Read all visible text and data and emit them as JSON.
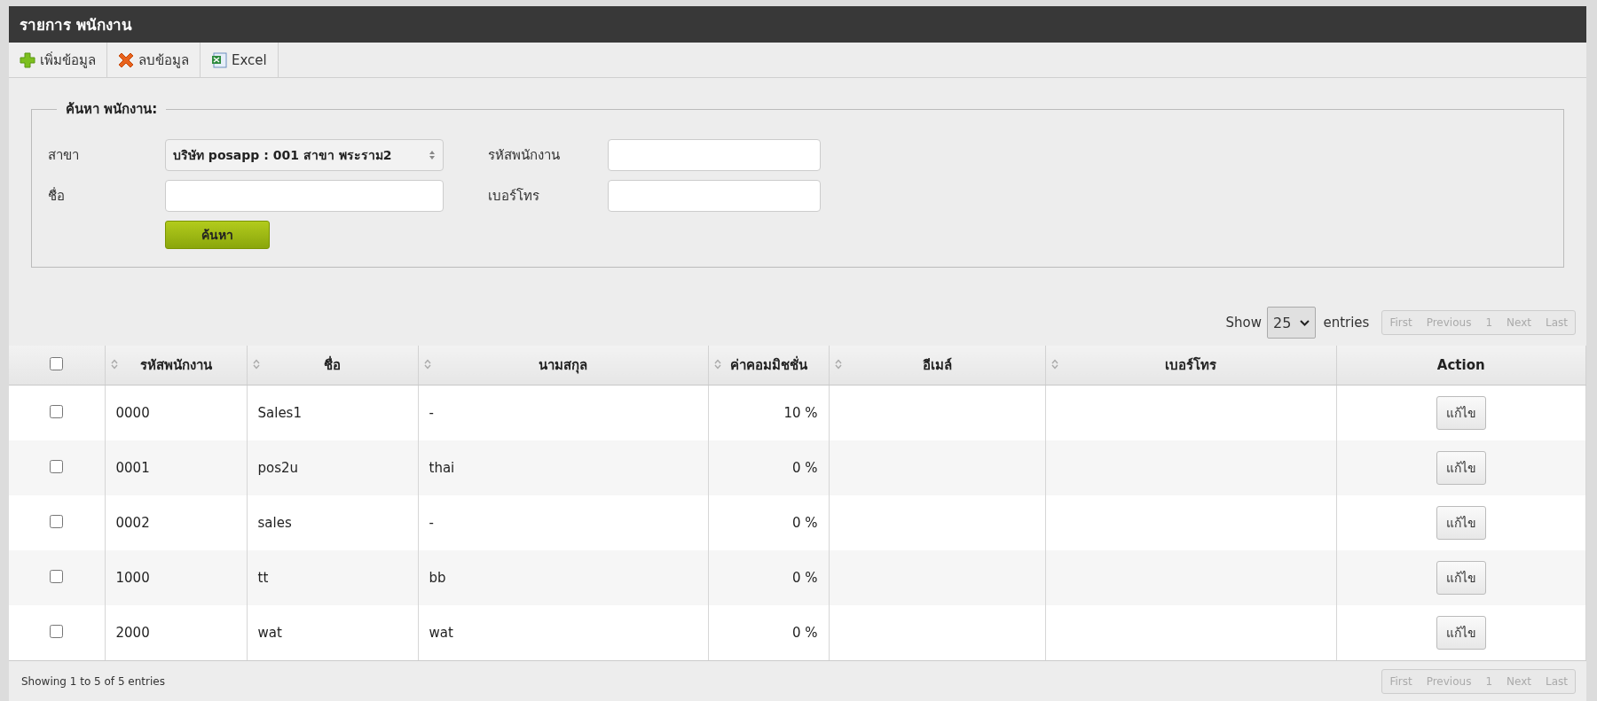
{
  "window": {
    "title": "รายการ พนักงาน"
  },
  "toolbar": [
    {
      "kind": "add",
      "label": "เพิ่มข้อมูล"
    },
    {
      "kind": "delete",
      "label": "ลบข้อมูล"
    },
    {
      "kind": "excel",
      "label": "Excel"
    }
  ],
  "search": {
    "legend": "ค้นหา พนักงาน:",
    "fields": [
      {
        "kind": "select",
        "label": "สาขา",
        "value": "บริษัท posapp : 001 สาขา พระราม2"
      },
      {
        "kind": "text",
        "label": "รหัสพนักงาน"
      },
      {
        "kind": "text",
        "label": "ชื่อ"
      },
      {
        "kind": "text",
        "label": "เบอร์โทร"
      }
    ],
    "button": "ค้นหา"
  },
  "length": {
    "before": "Show",
    "value": "25",
    "after": "entries"
  },
  "pagination_top": [
    {
      "label": "First",
      "disabled": true
    },
    {
      "label": "Previous",
      "disabled": true
    },
    {
      "label": "1",
      "disabled": true
    },
    {
      "label": "Next",
      "disabled": true
    },
    {
      "label": "Last",
      "disabled": true
    }
  ],
  "table": {
    "select_all": {
      "checked": false
    },
    "columns": [
      {
        "label": "รหัสพนักงาน",
        "sortable": true
      },
      {
        "label": "ชื่อ",
        "sortable": true
      },
      {
        "label": "นามสกุล",
        "sortable": true
      },
      {
        "label": "ค่าคอมมิชชั่น",
        "sortable": true
      },
      {
        "label": "อีเมล์",
        "sortable": true
      },
      {
        "label": "เบอร์โทร",
        "sortable": true
      },
      {
        "label": "Action",
        "sortable": false
      }
    ],
    "rows": [
      {
        "checked": false,
        "cells": [
          "0000",
          "Sales1",
          "-",
          "10 %",
          "",
          ""
        ],
        "action": "แก้ไข"
      },
      {
        "checked": false,
        "cells": [
          "0001",
          "pos2u",
          "thai",
          "0 %",
          "",
          ""
        ],
        "action": "แก้ไข"
      },
      {
        "checked": false,
        "cells": [
          "0002",
          "sales",
          "-",
          "0 %",
          "",
          ""
        ],
        "action": "แก้ไข"
      },
      {
        "checked": false,
        "cells": [
          "1000",
          "tt",
          "bb",
          "0 %",
          "",
          ""
        ],
        "action": "แก้ไข"
      },
      {
        "checked": false,
        "cells": [
          "2000",
          "wat",
          "wat",
          "0 %",
          "",
          ""
        ],
        "action": "แก้ไข"
      }
    ]
  },
  "info": "Showing 1 to 5 of 5 entries",
  "pagination_bottom": [
    {
      "label": "First",
      "disabled": true
    },
    {
      "label": "Previous",
      "disabled": true
    },
    {
      "label": "1",
      "disabled": true
    },
    {
      "label": "Next",
      "disabled": true
    },
    {
      "label": "Last",
      "disabled": true
    }
  ]
}
